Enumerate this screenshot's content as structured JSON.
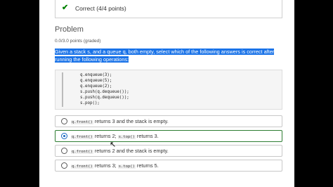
{
  "feedback": {
    "icon": "checkmark-icon",
    "text": "Correct (4/4 points)",
    "color": "#008100"
  },
  "problem": {
    "title": "Problem",
    "points": "0.0/3.0 points (graded)",
    "question_parts": [
      "Given a stack ",
      "s",
      ", and a queue ",
      "q",
      ", both empty, select which of the following answers is correct after running the following operations:"
    ]
  },
  "code_lines": [
    "q.enqueue(3);",
    "q.enqueue(5);",
    "q.enqueue(2);",
    "s.push(q.dequeue());",
    "s.push(q.dequeue());",
    "s.pop();"
  ],
  "options": [
    {
      "code1": "q.front()",
      "text1": " returns 3 and the stack is empty.",
      "code2": "",
      "text2": "",
      "selected": false
    },
    {
      "code1": "q.front()",
      "text1": " returns 2; ",
      "code2": "s.top()",
      "text2": " returns 3.",
      "selected": true
    },
    {
      "code1": "q.front()",
      "text1": " returns 2 and the stack is empty.",
      "code2": "",
      "text2": "",
      "selected": false
    },
    {
      "code1": "q.front()",
      "text1": " returns 3; ",
      "code2": "s.top()",
      "text2": " returns 5.",
      "selected": false
    }
  ]
}
